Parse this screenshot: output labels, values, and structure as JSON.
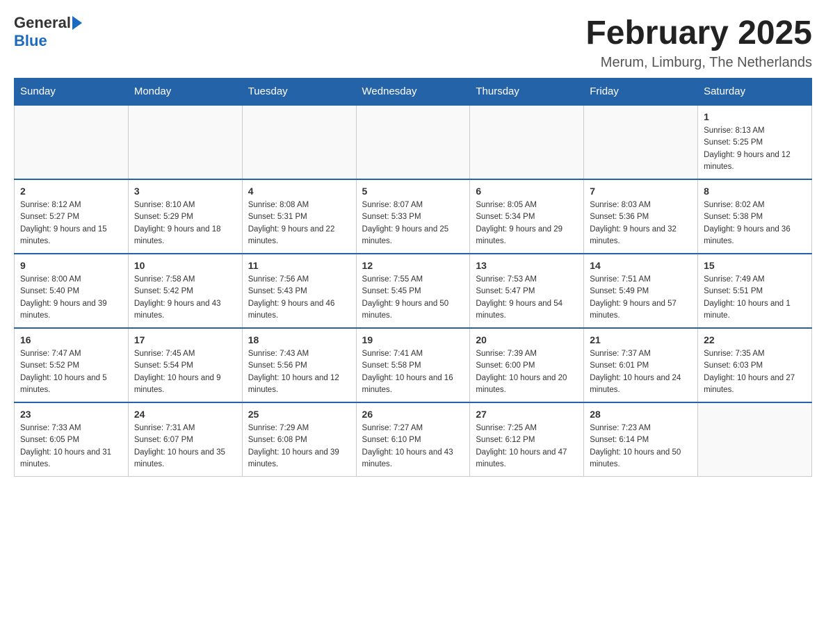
{
  "header": {
    "logo": {
      "general": "General",
      "blue": "Blue"
    },
    "title": "February 2025",
    "location": "Merum, Limburg, The Netherlands"
  },
  "weekdays": [
    "Sunday",
    "Monday",
    "Tuesday",
    "Wednesday",
    "Thursday",
    "Friday",
    "Saturday"
  ],
  "weeks": [
    [
      {
        "day": "",
        "sunrise": "",
        "sunset": "",
        "daylight": ""
      },
      {
        "day": "",
        "sunrise": "",
        "sunset": "",
        "daylight": ""
      },
      {
        "day": "",
        "sunrise": "",
        "sunset": "",
        "daylight": ""
      },
      {
        "day": "",
        "sunrise": "",
        "sunset": "",
        "daylight": ""
      },
      {
        "day": "",
        "sunrise": "",
        "sunset": "",
        "daylight": ""
      },
      {
        "day": "",
        "sunrise": "",
        "sunset": "",
        "daylight": ""
      },
      {
        "day": "1",
        "sunrise": "Sunrise: 8:13 AM",
        "sunset": "Sunset: 5:25 PM",
        "daylight": "Daylight: 9 hours and 12 minutes."
      }
    ],
    [
      {
        "day": "2",
        "sunrise": "Sunrise: 8:12 AM",
        "sunset": "Sunset: 5:27 PM",
        "daylight": "Daylight: 9 hours and 15 minutes."
      },
      {
        "day": "3",
        "sunrise": "Sunrise: 8:10 AM",
        "sunset": "Sunset: 5:29 PM",
        "daylight": "Daylight: 9 hours and 18 minutes."
      },
      {
        "day": "4",
        "sunrise": "Sunrise: 8:08 AM",
        "sunset": "Sunset: 5:31 PM",
        "daylight": "Daylight: 9 hours and 22 minutes."
      },
      {
        "day": "5",
        "sunrise": "Sunrise: 8:07 AM",
        "sunset": "Sunset: 5:33 PM",
        "daylight": "Daylight: 9 hours and 25 minutes."
      },
      {
        "day": "6",
        "sunrise": "Sunrise: 8:05 AM",
        "sunset": "Sunset: 5:34 PM",
        "daylight": "Daylight: 9 hours and 29 minutes."
      },
      {
        "day": "7",
        "sunrise": "Sunrise: 8:03 AM",
        "sunset": "Sunset: 5:36 PM",
        "daylight": "Daylight: 9 hours and 32 minutes."
      },
      {
        "day": "8",
        "sunrise": "Sunrise: 8:02 AM",
        "sunset": "Sunset: 5:38 PM",
        "daylight": "Daylight: 9 hours and 36 minutes."
      }
    ],
    [
      {
        "day": "9",
        "sunrise": "Sunrise: 8:00 AM",
        "sunset": "Sunset: 5:40 PM",
        "daylight": "Daylight: 9 hours and 39 minutes."
      },
      {
        "day": "10",
        "sunrise": "Sunrise: 7:58 AM",
        "sunset": "Sunset: 5:42 PM",
        "daylight": "Daylight: 9 hours and 43 minutes."
      },
      {
        "day": "11",
        "sunrise": "Sunrise: 7:56 AM",
        "sunset": "Sunset: 5:43 PM",
        "daylight": "Daylight: 9 hours and 46 minutes."
      },
      {
        "day": "12",
        "sunrise": "Sunrise: 7:55 AM",
        "sunset": "Sunset: 5:45 PM",
        "daylight": "Daylight: 9 hours and 50 minutes."
      },
      {
        "day": "13",
        "sunrise": "Sunrise: 7:53 AM",
        "sunset": "Sunset: 5:47 PM",
        "daylight": "Daylight: 9 hours and 54 minutes."
      },
      {
        "day": "14",
        "sunrise": "Sunrise: 7:51 AM",
        "sunset": "Sunset: 5:49 PM",
        "daylight": "Daylight: 9 hours and 57 minutes."
      },
      {
        "day": "15",
        "sunrise": "Sunrise: 7:49 AM",
        "sunset": "Sunset: 5:51 PM",
        "daylight": "Daylight: 10 hours and 1 minute."
      }
    ],
    [
      {
        "day": "16",
        "sunrise": "Sunrise: 7:47 AM",
        "sunset": "Sunset: 5:52 PM",
        "daylight": "Daylight: 10 hours and 5 minutes."
      },
      {
        "day": "17",
        "sunrise": "Sunrise: 7:45 AM",
        "sunset": "Sunset: 5:54 PM",
        "daylight": "Daylight: 10 hours and 9 minutes."
      },
      {
        "day": "18",
        "sunrise": "Sunrise: 7:43 AM",
        "sunset": "Sunset: 5:56 PM",
        "daylight": "Daylight: 10 hours and 12 minutes."
      },
      {
        "day": "19",
        "sunrise": "Sunrise: 7:41 AM",
        "sunset": "Sunset: 5:58 PM",
        "daylight": "Daylight: 10 hours and 16 minutes."
      },
      {
        "day": "20",
        "sunrise": "Sunrise: 7:39 AM",
        "sunset": "Sunset: 6:00 PM",
        "daylight": "Daylight: 10 hours and 20 minutes."
      },
      {
        "day": "21",
        "sunrise": "Sunrise: 7:37 AM",
        "sunset": "Sunset: 6:01 PM",
        "daylight": "Daylight: 10 hours and 24 minutes."
      },
      {
        "day": "22",
        "sunrise": "Sunrise: 7:35 AM",
        "sunset": "Sunset: 6:03 PM",
        "daylight": "Daylight: 10 hours and 27 minutes."
      }
    ],
    [
      {
        "day": "23",
        "sunrise": "Sunrise: 7:33 AM",
        "sunset": "Sunset: 6:05 PM",
        "daylight": "Daylight: 10 hours and 31 minutes."
      },
      {
        "day": "24",
        "sunrise": "Sunrise: 7:31 AM",
        "sunset": "Sunset: 6:07 PM",
        "daylight": "Daylight: 10 hours and 35 minutes."
      },
      {
        "day": "25",
        "sunrise": "Sunrise: 7:29 AM",
        "sunset": "Sunset: 6:08 PM",
        "daylight": "Daylight: 10 hours and 39 minutes."
      },
      {
        "day": "26",
        "sunrise": "Sunrise: 7:27 AM",
        "sunset": "Sunset: 6:10 PM",
        "daylight": "Daylight: 10 hours and 43 minutes."
      },
      {
        "day": "27",
        "sunrise": "Sunrise: 7:25 AM",
        "sunset": "Sunset: 6:12 PM",
        "daylight": "Daylight: 10 hours and 47 minutes."
      },
      {
        "day": "28",
        "sunrise": "Sunrise: 7:23 AM",
        "sunset": "Sunset: 6:14 PM",
        "daylight": "Daylight: 10 hours and 50 minutes."
      },
      {
        "day": "",
        "sunrise": "",
        "sunset": "",
        "daylight": ""
      }
    ]
  ]
}
